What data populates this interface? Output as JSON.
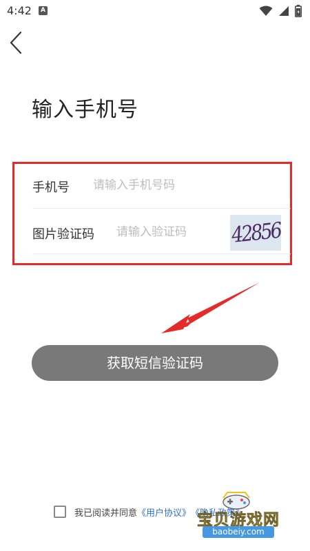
{
  "status_bar": {
    "time": "4:42",
    "app_icon_letter": "A"
  },
  "header": {
    "title": "输入手机号"
  },
  "form": {
    "phone": {
      "label": "手机号",
      "placeholder": "请输入手机号码",
      "value": ""
    },
    "captcha": {
      "label": "图片验证码",
      "placeholder": "请输入验证码",
      "value": "",
      "image_text": "42856"
    },
    "highlight_color": "#e52a2a"
  },
  "submit": {
    "label": "获取短信验证码",
    "color": "#797979"
  },
  "agreement": {
    "checked": false,
    "prefix": "我已阅读并同意",
    "user_agreement": "《用户协议》",
    "privacy_policy": "《隐私政策》"
  },
  "watermark": {
    "title": "宝贝游戏网",
    "url": "baobeiy.com"
  },
  "icons": {
    "back": "chevron-left-icon",
    "wifi": "wifi-icon",
    "signal": "signal-icon",
    "battery": "battery-icon",
    "arrow": "red-arrow-icon"
  }
}
